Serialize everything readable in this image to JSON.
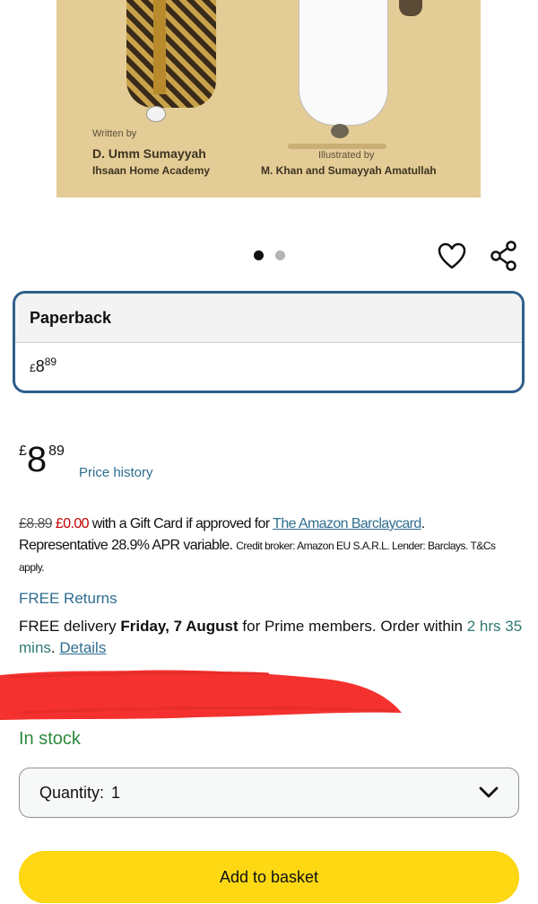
{
  "cover": {
    "written_by": "Written by",
    "author": "D. Umm Sumayyah",
    "academy": "Ihsaan Home Academy",
    "illustrated_by": "Illustrated by",
    "illustrators": "M. Khan and Sumayyah Amatullah"
  },
  "carousel": {
    "total_images": 2,
    "active_index": 1
  },
  "icons": {
    "wishlist": "heart-icon",
    "share": "share-icon",
    "dropdown": "chevron-down-icon"
  },
  "format": {
    "label": "Paperback",
    "price_currency": "£",
    "price_whole": "8",
    "price_fraction": "89"
  },
  "price": {
    "currency": "£",
    "whole": "8",
    "fraction": "89",
    "history_link": "Price history"
  },
  "gift_offer": {
    "old_price": "£8.89",
    "new_price": "£0.00",
    "text1": " with a Gift Card if approved for ",
    "card_link": "The Amazon Barclaycard",
    "text2": ".",
    "apr_text": "Representative 28.9% APR variable. ",
    "small_print": "Credit broker: Amazon EU S.A.R.L. Lender: Barclays. T&Cs apply."
  },
  "returns": "FREE Returns",
  "delivery": {
    "prefix": "FREE delivery ",
    "date": "Friday, 7 August",
    "suffix": " for Prime members. Order within ",
    "countdown": "2 hrs 35 mins",
    "sep": ". ",
    "details_link": "Details"
  },
  "stock_status": "In stock",
  "quantity": {
    "label": "Quantity:",
    "value": "1"
  },
  "add_to_basket": "Add to basket",
  "colors": {
    "accent_blue": "#2f6e90",
    "format_border": "#2f5e8c",
    "in_stock_green": "#2d8a3d",
    "add_button_yellow": "#ffd814",
    "redaction_red": "#f4312f"
  }
}
